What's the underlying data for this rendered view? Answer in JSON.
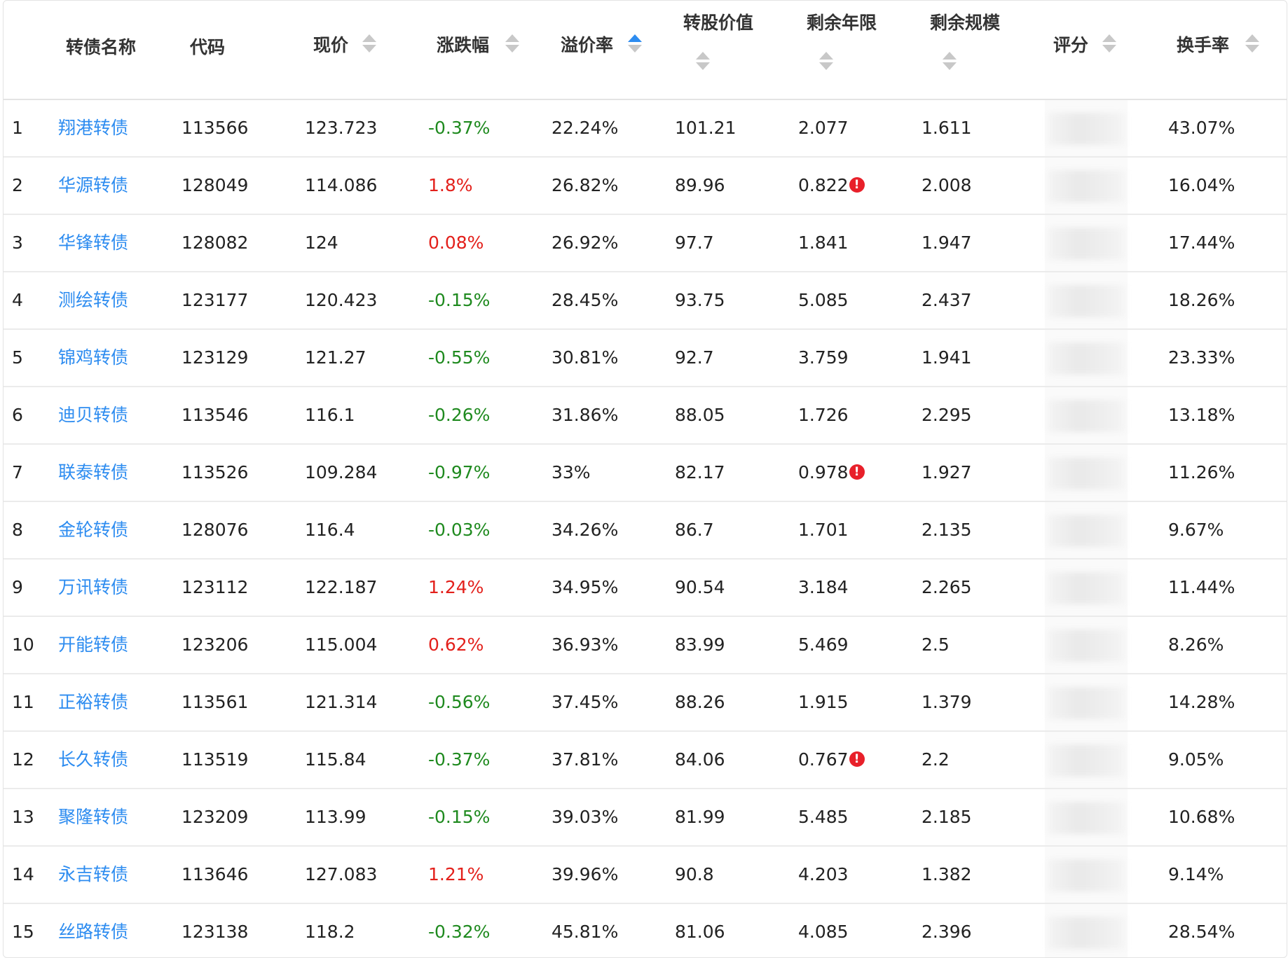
{
  "header": {
    "name": "转债名称",
    "code": "代码",
    "price": "现价",
    "change": "涨跌幅",
    "premium": "溢价率",
    "conv_value": "转股价值",
    "remaining_years": "剩余年限",
    "remaining_size": "剩余规模",
    "score": "评分",
    "turnover": "换手率"
  },
  "sort": {
    "active_column": "溢价率",
    "direction": "ascending",
    "active_color": "#2d8cf0",
    "inactive_color": "#c8c8c8"
  },
  "colors": {
    "name_link": "#2d8cf0",
    "positive": "#e3201b",
    "negative": "#1f8a1f",
    "warning": "#e8202a"
  },
  "rows": [
    {
      "idx": "1",
      "name": "翔港转债",
      "code": "113566",
      "price": "123.723",
      "change": "-0.37%",
      "premium": "22.24%",
      "conv_value": "101.21",
      "years": "2.077",
      "warn": false,
      "size": "1.611",
      "turnover": "43.07%"
    },
    {
      "idx": "2",
      "name": "华源转债",
      "code": "128049",
      "price": "114.086",
      "change": "1.8%",
      "premium": "26.82%",
      "conv_value": "89.96",
      "years": "0.822",
      "warn": true,
      "size": "2.008",
      "turnover": "16.04%"
    },
    {
      "idx": "3",
      "name": "华锋转债",
      "code": "128082",
      "price": "124",
      "change": "0.08%",
      "premium": "26.92%",
      "conv_value": "97.7",
      "years": "1.841",
      "warn": false,
      "size": "1.947",
      "turnover": "17.44%"
    },
    {
      "idx": "4",
      "name": "测绘转债",
      "code": "123177",
      "price": "120.423",
      "change": "-0.15%",
      "premium": "28.45%",
      "conv_value": "93.75",
      "years": "5.085",
      "warn": false,
      "size": "2.437",
      "turnover": "18.26%"
    },
    {
      "idx": "5",
      "name": "锦鸡转债",
      "code": "123129",
      "price": "121.27",
      "change": "-0.55%",
      "premium": "30.81%",
      "conv_value": "92.7",
      "years": "3.759",
      "warn": false,
      "size": "1.941",
      "turnover": "23.33%"
    },
    {
      "idx": "6",
      "name": "迪贝转债",
      "code": "113546",
      "price": "116.1",
      "change": "-0.26%",
      "premium": "31.86%",
      "conv_value": "88.05",
      "years": "1.726",
      "warn": false,
      "size": "2.295",
      "turnover": "13.18%"
    },
    {
      "idx": "7",
      "name": "联泰转债",
      "code": "113526",
      "price": "109.284",
      "change": "-0.97%",
      "premium": "33%",
      "conv_value": "82.17",
      "years": "0.978",
      "warn": true,
      "size": "1.927",
      "turnover": "11.26%"
    },
    {
      "idx": "8",
      "name": "金轮转债",
      "code": "128076",
      "price": "116.4",
      "change": "-0.03%",
      "premium": "34.26%",
      "conv_value": "86.7",
      "years": "1.701",
      "warn": false,
      "size": "2.135",
      "turnover": "9.67%"
    },
    {
      "idx": "9",
      "name": "万讯转债",
      "code": "123112",
      "price": "122.187",
      "change": "1.24%",
      "premium": "34.95%",
      "conv_value": "90.54",
      "years": "3.184",
      "warn": false,
      "size": "2.265",
      "turnover": "11.44%"
    },
    {
      "idx": "10",
      "name": "开能转债",
      "code": "123206",
      "price": "115.004",
      "change": "0.62%",
      "premium": "36.93%",
      "conv_value": "83.99",
      "years": "5.469",
      "warn": false,
      "size": "2.5",
      "turnover": "8.26%"
    },
    {
      "idx": "11",
      "name": "正裕转债",
      "code": "113561",
      "price": "121.314",
      "change": "-0.56%",
      "premium": "37.45%",
      "conv_value": "88.26",
      "years": "1.915",
      "warn": false,
      "size": "1.379",
      "turnover": "14.28%"
    },
    {
      "idx": "12",
      "name": "长久转债",
      "code": "113519",
      "price": "115.84",
      "change": "-0.37%",
      "premium": "37.81%",
      "conv_value": "84.06",
      "years": "0.767",
      "warn": true,
      "size": "2.2",
      "turnover": "9.05%"
    },
    {
      "idx": "13",
      "name": "聚隆转债",
      "code": "123209",
      "price": "113.99",
      "change": "-0.15%",
      "premium": "39.03%",
      "conv_value": "81.99",
      "years": "5.485",
      "warn": false,
      "size": "2.185",
      "turnover": "10.68%"
    },
    {
      "idx": "14",
      "name": "永吉转债",
      "code": "113646",
      "price": "127.083",
      "change": "1.21%",
      "premium": "39.96%",
      "conv_value": "90.8",
      "years": "4.203",
      "warn": false,
      "size": "1.382",
      "turnover": "9.14%"
    },
    {
      "idx": "15",
      "name": "丝路转债",
      "code": "123138",
      "price": "118.2",
      "change": "-0.32%",
      "premium": "45.81%",
      "conv_value": "81.06",
      "years": "4.085",
      "warn": false,
      "size": "2.396",
      "turnover": "28.54%"
    }
  ],
  "warning_glyph": "!",
  "warning_icon": "exclamation-circle-icon"
}
